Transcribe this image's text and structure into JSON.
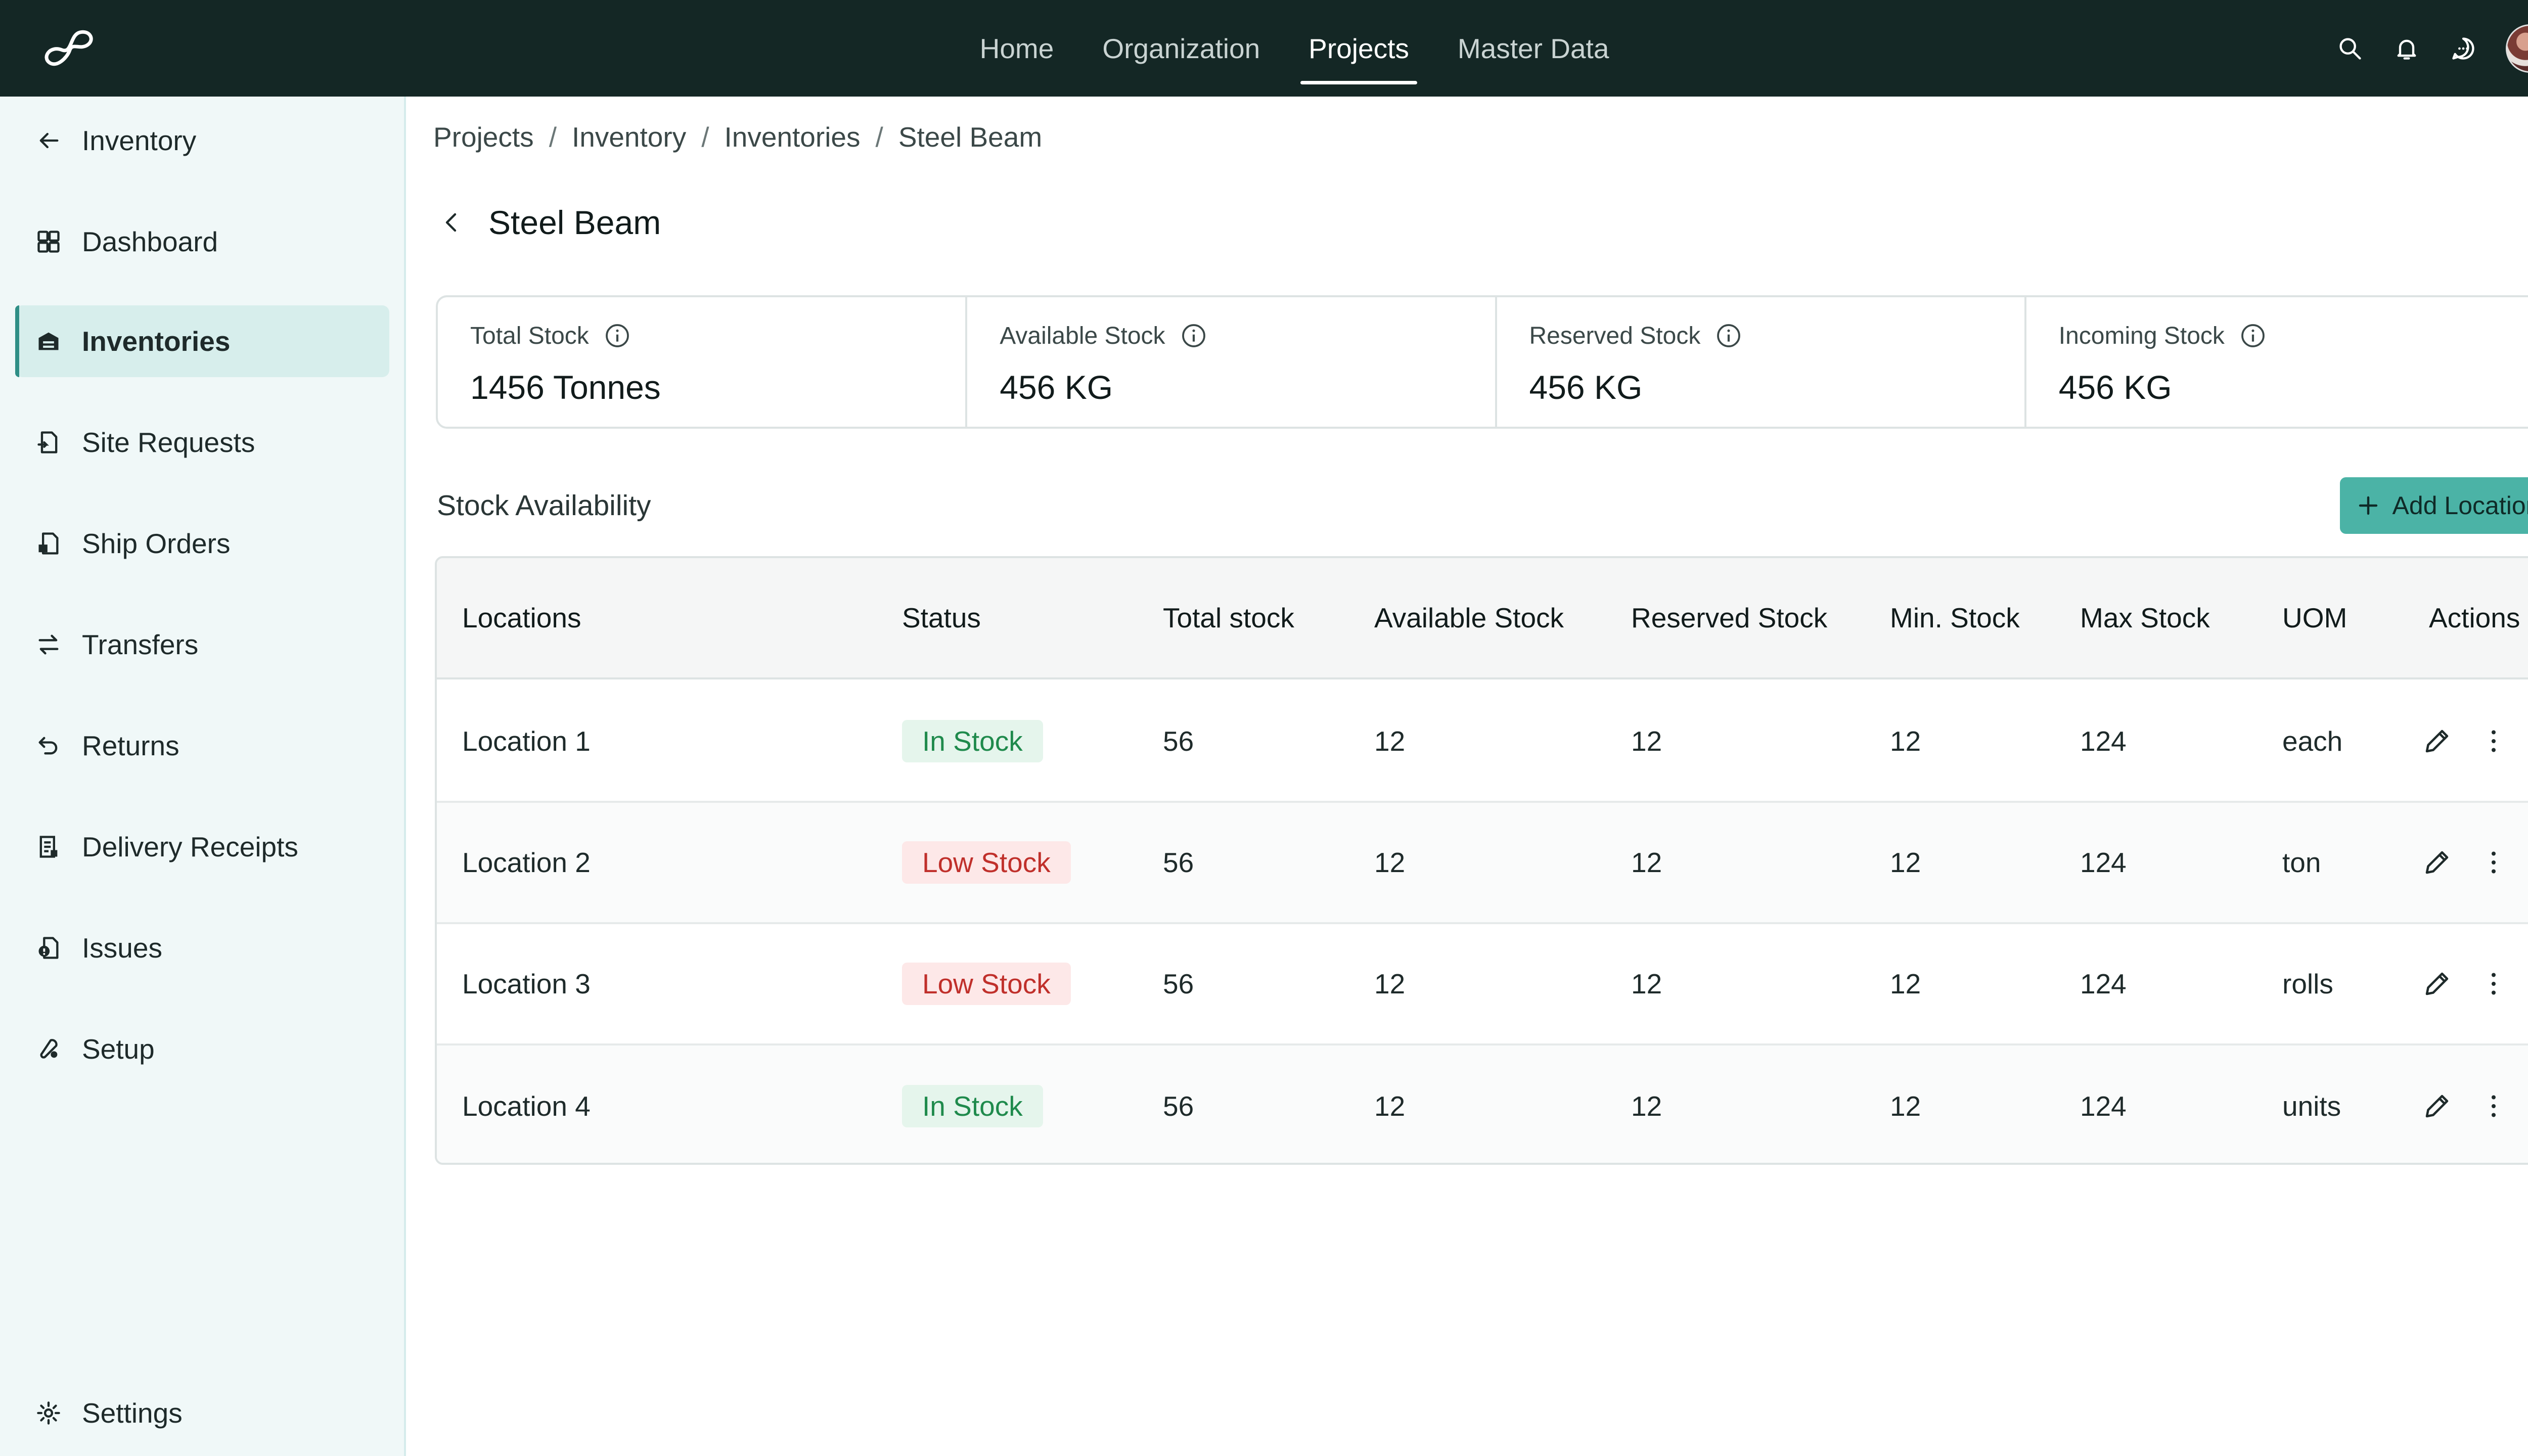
{
  "topnav": {
    "items": [
      "Home",
      "Organization",
      "Projects",
      "Master Data"
    ],
    "active": "Projects",
    "icons": [
      "search-icon",
      "bell-icon",
      "chat-icon"
    ]
  },
  "sidebar": {
    "back_label": "Inventory",
    "items": [
      {
        "label": "Dashboard",
        "icon": "dashboard-icon"
      },
      {
        "label": "Inventories",
        "icon": "warehouse-icon",
        "active": true
      },
      {
        "label": "Site Requests",
        "icon": "request-icon"
      },
      {
        "label": "Ship Orders",
        "icon": "ship-orders-icon"
      },
      {
        "label": "Transfers",
        "icon": "transfer-icon"
      },
      {
        "label": "Returns",
        "icon": "return-icon"
      },
      {
        "label": "Delivery Receipts",
        "icon": "receipt-icon"
      },
      {
        "label": "Issues",
        "icon": "issue-icon"
      },
      {
        "label": "Setup",
        "icon": "setup-icon"
      }
    ],
    "settings_label": "Settings"
  },
  "breadcrumb": [
    "Projects",
    "Inventory",
    "Inventories",
    "Steel Beam"
  ],
  "page": {
    "title": "Steel Beam"
  },
  "stats": [
    {
      "label": "Total Stock",
      "value": "1456 Tonnes"
    },
    {
      "label": "Available Stock",
      "value": "456 KG"
    },
    {
      "label": "Reserved Stock",
      "value": "456 KG"
    },
    {
      "label": "Incoming Stock",
      "value": "456 KG"
    }
  ],
  "section": {
    "title": "Stock Availability",
    "add_button": "Add Location"
  },
  "table": {
    "columns": [
      "Locations",
      "Status",
      "Total stock",
      "Available Stock",
      "Reserved Stock",
      "Min. Stock",
      "Max Stock",
      "UOM",
      "Actions"
    ],
    "rows": [
      {
        "location": "Location 1",
        "status": "In Stock",
        "status_type": "ok",
        "total": "56",
        "available": "12",
        "reserved": "12",
        "min": "12",
        "max": "124",
        "uom": "each"
      },
      {
        "location": "Location 2",
        "status": "Low Stock",
        "status_type": "low",
        "total": "56",
        "available": "12",
        "reserved": "12",
        "min": "12",
        "max": "124",
        "uom": "ton"
      },
      {
        "location": "Location 3",
        "status": "Low Stock",
        "status_type": "low",
        "total": "56",
        "available": "12",
        "reserved": "12",
        "min": "12",
        "max": "124",
        "uom": "rolls"
      },
      {
        "location": "Location 4",
        "status": "In Stock",
        "status_type": "ok",
        "total": "56",
        "available": "12",
        "reserved": "12",
        "min": "12",
        "max": "124",
        "uom": "units"
      }
    ]
  },
  "colors": {
    "topbar": "#142725",
    "accent": "#4bb3a6",
    "sidebar_bg": "#f0f8f8",
    "in_stock": "#1f8a4c",
    "low_stock": "#c0302b"
  }
}
